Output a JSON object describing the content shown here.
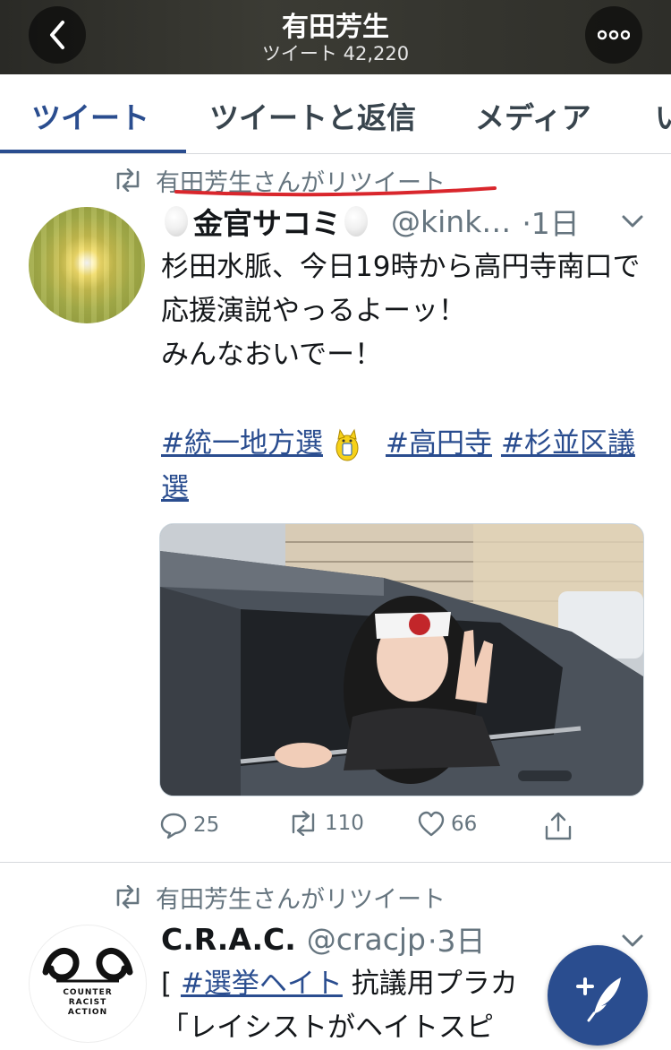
{
  "header": {
    "title": "有田芳生",
    "subtitle": "ツイート 42,220",
    "back_icon": "chevron-left-icon",
    "more_icon": "more-horizontal-icon"
  },
  "tabs": [
    {
      "label": "ツイート",
      "active": true
    },
    {
      "label": "ツイートと返信",
      "active": false
    },
    {
      "label": "メディア",
      "active": false
    },
    {
      "label": "い",
      "active": false
    }
  ],
  "tweets": [
    {
      "retweet_label": "有田芳生さんがリツイート",
      "name": "金官サコミ",
      "handle": "@kink…",
      "time": "·1日",
      "text": "杉田水脈、今日19時から高円寺南口で応援演説やっるよーッ！\nみんなおいでー！",
      "hashtags": [
        "#統一地方選",
        "#高円寺",
        "#杉並区議選"
      ],
      "stats": {
        "replies": "25",
        "retweets": "110",
        "likes": "66"
      }
    },
    {
      "retweet_label": "有田芳生さんがリツイート",
      "name": "C.R.A.C.",
      "handle": "@cracjp",
      "time": "·3日",
      "text_prefix": "[ ",
      "hashtag": "#選挙ヘイト",
      "text_after": " 抗議用プラカ",
      "text_line2": "「レイシストがヘイトスピ",
      "avatar_logo_text": [
        "COUNTER",
        "RACIST",
        "ACTION"
      ]
    }
  ],
  "colors": {
    "accent": "#2a4d8f",
    "muted": "#66757f",
    "annotation_red": "#d9262c"
  }
}
